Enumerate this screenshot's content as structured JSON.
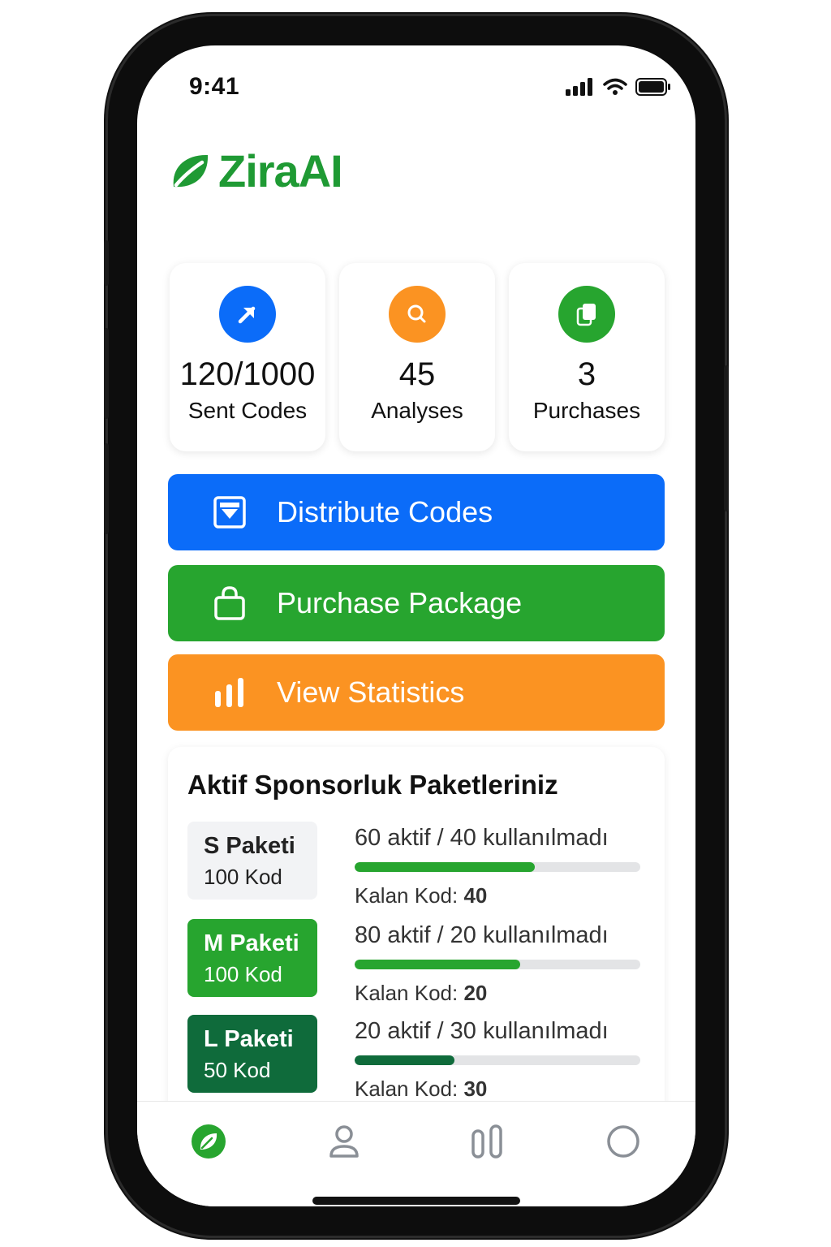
{
  "status_bar": {
    "time": "9:41"
  },
  "app": {
    "name": "ZiraAI"
  },
  "stats": [
    {
      "value": "120/1000",
      "label": "Sent Codes",
      "icon": "arrow-up-right-icon",
      "color": "#0b6cf9"
    },
    {
      "value": "45",
      "label": "Analyses",
      "icon": "search-icon",
      "color": "#fb9322"
    },
    {
      "value": "3",
      "label": "Purchases",
      "icon": "documents-icon",
      "color": "#27a52f"
    }
  ],
  "actions": [
    {
      "label": "Distribute Codes",
      "icon": "download-box-icon",
      "color": "#0b6cf9"
    },
    {
      "label": "Purchase Package",
      "icon": "shopping-bag-icon",
      "color": "#27a52f"
    },
    {
      "label": "View Statistics",
      "icon": "bar-chart-icon",
      "color": "#fb9322"
    }
  ],
  "packages": {
    "title": "Aktif Sponsorluk Paketleriniz",
    "remaining_label": "Kalan Kod:",
    "items": [
      {
        "name": "S Paketi",
        "count": "100 Kod",
        "status": "60 aktif / 40 kullanılmadı",
        "remaining": "40",
        "progress": 0.63,
        "bar_color": "#27a52f"
      },
      {
        "name": "M Paketi",
        "count": "100 Kod",
        "status": "80 aktif / 20 kullanılmadı",
        "remaining": "20",
        "progress": 0.58,
        "bar_color": "#27a52f"
      },
      {
        "name": "L Paketi",
        "count": "50 Kod",
        "status": "20 aktif / 30 kullanılmadı",
        "remaining": "30",
        "progress": 0.35,
        "bar_color": "#0f6b3b"
      }
    ]
  },
  "bottom_nav": [
    {
      "name": "home",
      "icon": "leaf-icon",
      "active": true
    },
    {
      "name": "profile",
      "icon": "user-icon",
      "active": false
    },
    {
      "name": "statistics",
      "icon": "columns-icon",
      "active": false
    },
    {
      "name": "more",
      "icon": "circle-icon",
      "active": false
    }
  ]
}
